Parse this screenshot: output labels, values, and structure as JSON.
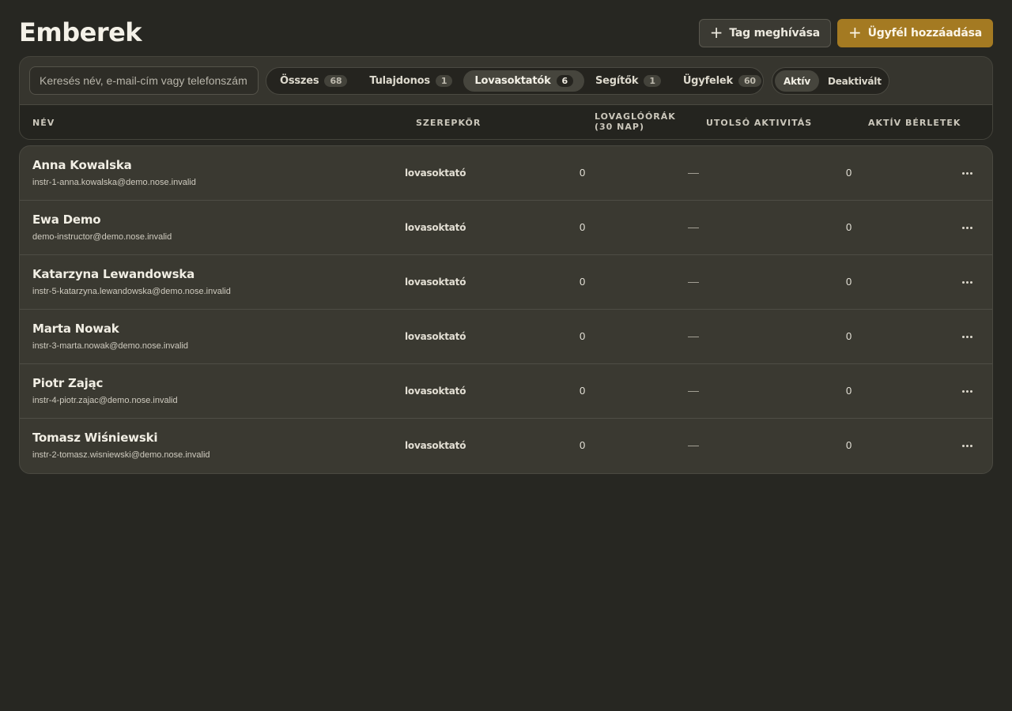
{
  "header": {
    "title": "Emberek",
    "invite_label": "Tag meghívása",
    "add_client_label": "Ügyfél hozzáadása"
  },
  "filters": {
    "search_placeholder": "Keresés név, e-mail-cím vagy telefonszám alapján",
    "roles": [
      {
        "label": "Összes",
        "count": "68",
        "active": false
      },
      {
        "label": "Tulajdonos",
        "count": "1",
        "active": false
      },
      {
        "label": "Lovasoktatók",
        "count": "6",
        "active": true
      },
      {
        "label": "Segítők",
        "count": "1",
        "active": false
      },
      {
        "label": "Ügyfelek",
        "count": "60",
        "active": false
      }
    ],
    "status": [
      {
        "label": "Aktív",
        "active": true
      },
      {
        "label": "Deaktivált",
        "active": false
      }
    ]
  },
  "table": {
    "columns": {
      "name": "Név",
      "role": "Szerepkör",
      "hours": "Lovaglóórák (30 nap)",
      "last_activity": "Utolsó aktivitás",
      "passes": "Aktív bérletek"
    },
    "rows": [
      {
        "name": "Anna Kowalska",
        "email": "instr-1-anna.kowalska@demo.nose.invalid",
        "role": "lovasoktató",
        "hours": "0",
        "last_activity": "—",
        "passes": "0"
      },
      {
        "name": "Ewa Demo",
        "email": "demo-instructor@demo.nose.invalid",
        "role": "lovasoktató",
        "hours": "0",
        "last_activity": "—",
        "passes": "0"
      },
      {
        "name": "Katarzyna Lewandowska",
        "email": "instr-5-katarzyna.lewandowska@demo.nose.invalid",
        "role": "lovasoktató",
        "hours": "0",
        "last_activity": "—",
        "passes": "0"
      },
      {
        "name": "Marta Nowak",
        "email": "instr-3-marta.nowak@demo.nose.invalid",
        "role": "lovasoktató",
        "hours": "0",
        "last_activity": "—",
        "passes": "0"
      },
      {
        "name": "Piotr Zając",
        "email": "instr-4-piotr.zajac@demo.nose.invalid",
        "role": "lovasoktató",
        "hours": "0",
        "last_activity": "—",
        "passes": "0"
      },
      {
        "name": "Tomasz Wiśniewski",
        "email": "instr-2-tomasz.wisniewski@demo.nose.invalid",
        "role": "lovasoktató",
        "hours": "0",
        "last_activity": "—",
        "passes": "0"
      }
    ]
  },
  "icons": {
    "add": "plus-icon",
    "row_menu": "more-horizontal-icon"
  },
  "colors": {
    "background": "#272722",
    "accent": "#a47a22"
  }
}
